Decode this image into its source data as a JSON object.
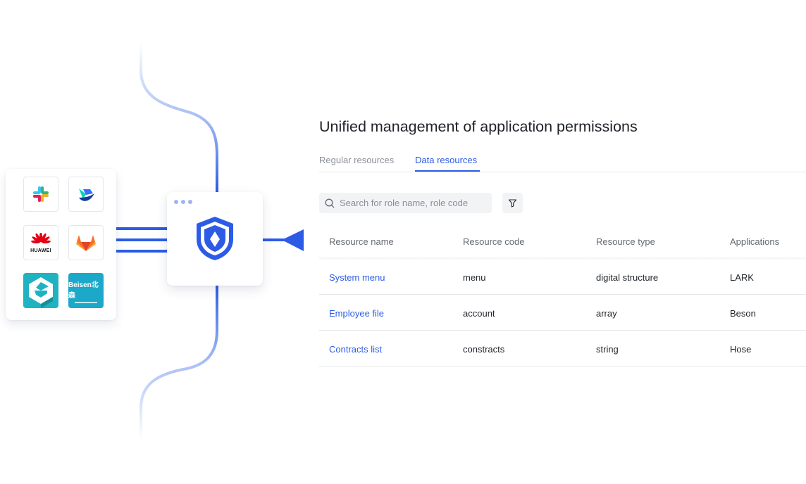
{
  "integrations": {
    "apps": [
      {
        "name": "slack",
        "label": ""
      },
      {
        "name": "feishu",
        "label": ""
      },
      {
        "name": "huawei",
        "label": "HUAWEI"
      },
      {
        "name": "gitlab",
        "label": ""
      },
      {
        "name": "e-app",
        "label": ""
      },
      {
        "name": "beisen",
        "label": "Beisen北森"
      }
    ],
    "hub_icon": "shield-icon",
    "accent_color": "#2c5ce6"
  },
  "panel": {
    "title": "Unified management of application permissions",
    "tabs": [
      {
        "label": "Regular resources",
        "active": false
      },
      {
        "label": "Data resources",
        "active": true
      }
    ],
    "search": {
      "placeholder": "Search for role name, role code",
      "value": ""
    },
    "filter_icon": "filter-icon",
    "table": {
      "columns": [
        "Resource name",
        "Resource code",
        "Resource type",
        "Applications"
      ],
      "rows": [
        [
          "System menu",
          "menu",
          "digital structure",
          "LARK"
        ],
        [
          "Employee file",
          "account",
          "array",
          "Beson"
        ],
        [
          "Contracts list",
          "constracts",
          "string",
          "Hose"
        ]
      ]
    }
  }
}
